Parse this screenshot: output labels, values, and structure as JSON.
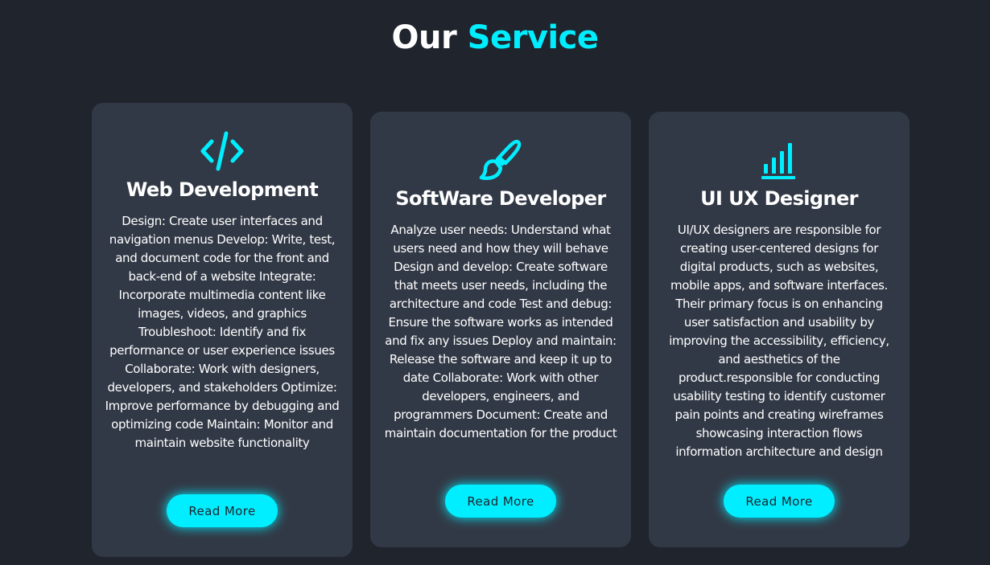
{
  "header": {
    "title_main": "Our",
    "title_accent": "Service"
  },
  "colors": {
    "background": "#1f242d",
    "card": "#323946",
    "accent": "#00eeff",
    "text": "#ffffff"
  },
  "cards": [
    {
      "icon": "code-icon",
      "title": "Web Development",
      "description": "Design: Create user interfaces and navigation menus Develop: Write, test, and document code for the front and back-end of a website Integrate: Incorporate multimedia content like images, videos, and graphics Troubleshoot: Identify and fix performance or user experience issues Collaborate: Work with designers, developers, and stakeholders Optimize: Improve performance by debugging and optimizing code Maintain: Monitor and maintain website functionality",
      "button_label": "Read More"
    },
    {
      "icon": "paintbrush-icon",
      "title": "SoftWare Developer",
      "description": "Analyze user needs: Understand what users need and how they will behave Design and develop: Create software that meets user needs, including the architecture and code Test and debug: Ensure the software works as intended and fix any issues Deploy and maintain: Release the software and keep it up to date Collaborate: Work with other developers, engineers, and programmers Document: Create and maintain documentation for the product",
      "button_label": "Read More"
    },
    {
      "icon": "bar-chart-icon",
      "title": "UI UX Designer",
      "description": "UI/UX designers are responsible for creating user-centered designs for digital products, such as websites, mobile apps, and software interfaces. Their primary focus is on enhancing user satisfaction and usability by improving the accessibility, efficiency, and aesthetics of the product.responsible for conducting usability testing to identify customer pain points and creating wireframes showcasing interaction flows information architecture and design",
      "button_label": "Read More"
    }
  ]
}
